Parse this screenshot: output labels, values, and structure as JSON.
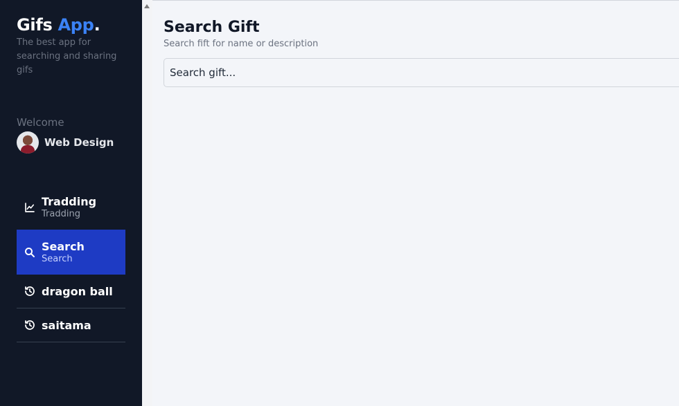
{
  "app": {
    "name": "Gifs",
    "name_accent": "App",
    "name_dot": ".",
    "tagline": "The best app for searching and sharing gifs"
  },
  "user": {
    "welcome": "Welcome",
    "name": "Web Design"
  },
  "menu": [
    {
      "title": "Tradding",
      "subtitle": "Tradding",
      "icon": "trending-chart-icon",
      "active": false
    },
    {
      "title": "Search",
      "subtitle": "Search",
      "icon": "search-icon",
      "active": true
    }
  ],
  "history": [
    {
      "title": "dragon ball",
      "icon": "history-icon"
    },
    {
      "title": "saitama",
      "icon": "history-icon"
    }
  ],
  "main": {
    "title": "Search Gift",
    "subtitle": "Search fift for name or description",
    "search_placeholder": "Search gift..."
  },
  "colors": {
    "sidebar_bg": "#111827",
    "accent": "#3b82f6",
    "active_bg": "#1e3bc4",
    "main_bg": "#f3f5f9"
  }
}
